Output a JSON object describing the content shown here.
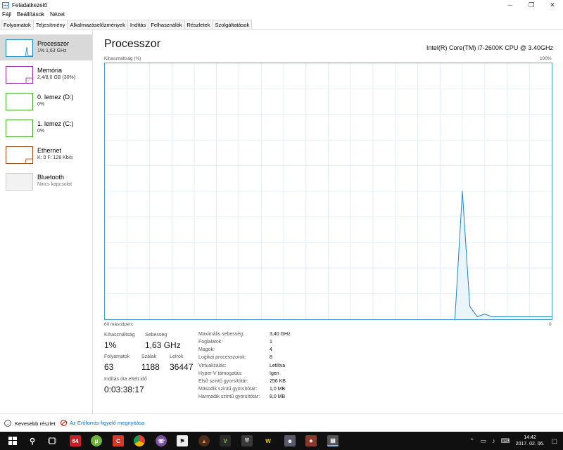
{
  "window": {
    "title": "Feladatkezelő",
    "controls": {
      "minimize": "─",
      "maximize": "❐",
      "close": "✕"
    }
  },
  "menu": [
    "Fájl",
    "Beállítások",
    "Nézet"
  ],
  "tabs": [
    "Folyamatok",
    "Teljesítmény",
    "Alkalmazáselőzmények",
    "Indítás",
    "Felhasználók",
    "Részletek",
    "Szolgáltatások"
  ],
  "active_tab": "Teljesítmény",
  "sidebar": [
    {
      "title": "Processzor",
      "subtitle": "1% 1,63 GHz",
      "color": "#1a86c8"
    },
    {
      "title": "Memória",
      "subtitle": "2,4/8,0 GB (30%)",
      "color": "#9b2fae"
    },
    {
      "title": "0. lemez (D:)",
      "subtitle": "0%",
      "color": "#4aad2e"
    },
    {
      "title": "1. lemez (C:)",
      "subtitle": "0%",
      "color": "#4aad2e"
    },
    {
      "title": "Ethernet",
      "subtitle": "K: 0 F: 128 Kb/s",
      "color": "#a8501c"
    },
    {
      "title": "Bluetooth",
      "subtitle": "Nincs kapcsolat",
      "color": "#bbbbbb"
    }
  ],
  "main": {
    "title": "Processzor",
    "cpu_name": "Intel(R) Core(TM) i7-2600K CPU @ 3.40GHz",
    "axis": {
      "top_left": "Kihasználtság (%)",
      "top_right": "100%",
      "bottom_left": "60 másodperc",
      "bottom_right": "0"
    },
    "stats": {
      "utilization_label": "Kihasználtság",
      "utilization_value": "1%",
      "speed_label": "Sebesség",
      "speed_value": "1,63 GHz",
      "processes_label": "Folyamatok",
      "processes_value": "63",
      "threads_label": "Szálak",
      "threads_value": "1188",
      "handles_label": "Leírók",
      "handles_value": "36447",
      "uptime_label": "Indítás óta eltelt idő",
      "uptime_value": "0:03:38:17"
    },
    "specs": [
      {
        "label": "Maximális sebesség:",
        "value": "3,40 GHz"
      },
      {
        "label": "Foglalatok:",
        "value": "1"
      },
      {
        "label": "Magok:",
        "value": "4"
      },
      {
        "label": "Logikai processzorok:",
        "value": "8"
      },
      {
        "label": "Virtualizálás:",
        "value": "Letiltva"
      },
      {
        "label": "Hyper-V támogatás:",
        "value": "Igen"
      },
      {
        "label": "Első szintű gyorsítótár:",
        "value": "256 KB"
      },
      {
        "label": "Második szintű gyorsítótár:",
        "value": "1,0 MB"
      },
      {
        "label": "Harmadik szintű gyorsítótár:",
        "value": "8,0 MB"
      }
    ]
  },
  "chart_data": {
    "type": "area",
    "x": [
      0,
      1,
      2,
      3,
      4,
      5,
      6,
      7,
      8,
      9,
      10,
      11,
      12,
      13,
      14,
      15,
      16,
      17,
      18,
      19,
      20,
      21,
      22,
      23,
      24,
      25,
      26,
      27,
      28,
      29,
      30,
      31,
      32,
      33,
      34,
      35,
      36,
      37,
      38,
      39,
      40,
      41,
      42,
      43,
      44,
      45,
      46,
      47,
      48,
      49,
      50,
      51,
      52,
      53,
      54,
      55,
      56,
      57,
      58,
      59,
      60
    ],
    "series": [
      {
        "values": [
          null,
          null,
          null,
          null,
          null,
          null,
          null,
          null,
          null,
          null,
          null,
          null,
          null,
          null,
          null,
          null,
          null,
          null,
          null,
          null,
          null,
          null,
          null,
          null,
          null,
          null,
          null,
          null,
          null,
          null,
          null,
          null,
          null,
          null,
          null,
          null,
          null,
          null,
          null,
          null,
          null,
          null,
          null,
          null,
          null,
          null,
          null,
          0,
          50,
          5,
          1,
          2,
          1,
          1,
          1,
          1,
          1,
          1,
          1,
          1,
          1
        ]
      }
    ],
    "xlabel": "60 másodperc",
    "ylabel": "Kihasználtság (%)",
    "xlim": [
      0,
      60
    ],
    "ylim": [
      0,
      100
    ],
    "grid": true,
    "color": "#1a86c8"
  },
  "footer": {
    "fewer_details": "Kevesebb részlet",
    "resource_monitor": "Az Erőforrás-figyelő megnyitása"
  },
  "taskbar": {
    "time": "14:42",
    "date": "2017. 02. 06."
  }
}
